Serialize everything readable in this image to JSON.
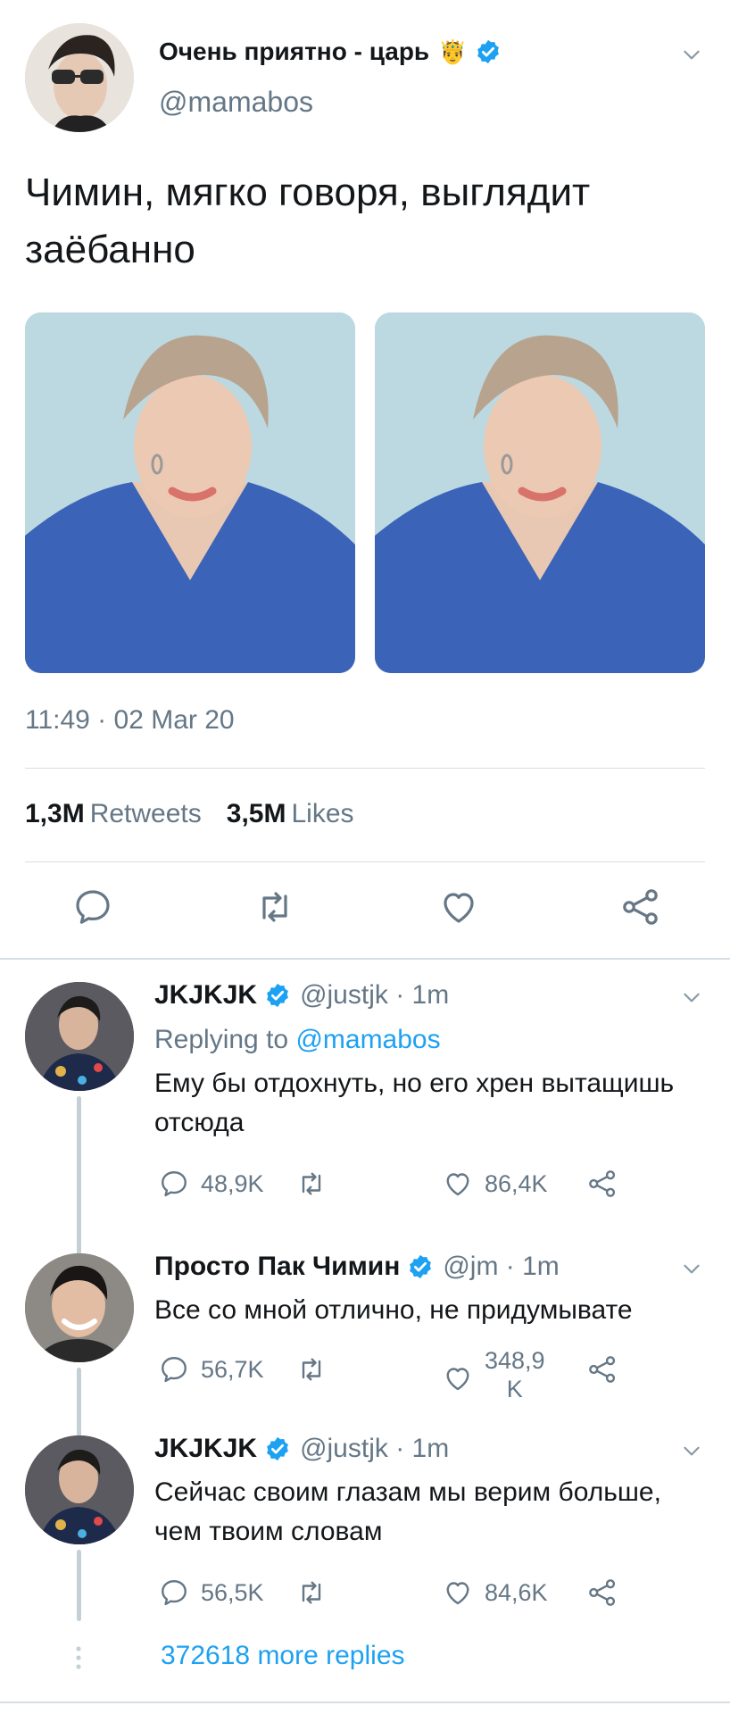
{
  "main_tweet": {
    "author": {
      "display_name": "Очень приятно - царь",
      "badge_emoji": "🤴",
      "handle": "@mamabos",
      "verified": true
    },
    "text": "Чимин, мягко говоря, выглядит заёбанно",
    "timestamp": "11:49 · 02 Mar 20",
    "stats": {
      "retweets_count": "1,3M",
      "retweets_label": "Retweets",
      "likes_count": "3,5M",
      "likes_label": "Likes"
    },
    "actions": [
      "reply-icon",
      "retweet-icon",
      "like-icon",
      "share-icon"
    ]
  },
  "replies": [
    {
      "display_name": "JKJKJK",
      "handle_time": "@justjk · 1m",
      "replying_to_label": "Replying to",
      "replying_to_handle": "@mamabos",
      "text": "Ему бы отдохнуть, но его хрен вытащишь отсюда",
      "reply_count": "48,9K",
      "like_count": "86,4K"
    },
    {
      "display_name": "Просто Пак Чимин",
      "handle_time": "@jm · 1m",
      "text": "Все со мной отлично, не придумывате",
      "reply_count": "56,7K",
      "like_count_line1": "348,9",
      "like_count_line2": "K"
    },
    {
      "display_name": "JKJKJK",
      "handle_time": "@justjk · 1m",
      "text": "Сейчас своим глазам мы верим больше, чем твоим словам",
      "reply_count": "56,5K",
      "like_count": "84,6K"
    }
  ],
  "more_replies": "372618 more replies",
  "colors": {
    "accent": "#1da1f2",
    "secondary_text": "#657786",
    "primary_text": "#14171a",
    "divider": "#d6dde3"
  }
}
